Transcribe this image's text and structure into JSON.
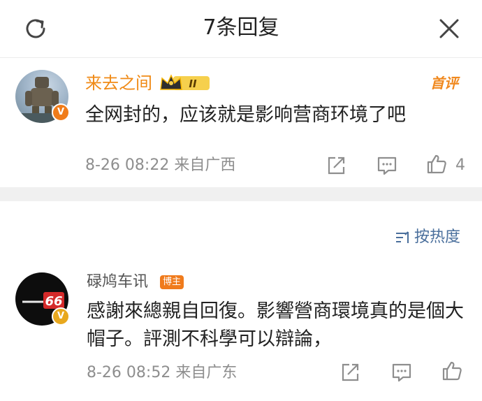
{
  "header": {
    "title": "7条回复"
  },
  "comment1": {
    "username": "来去之间",
    "level_badge": "II",
    "first_tag": "首评",
    "text": "全网封的，应该就是影响营商环境了吧",
    "timestamp": "8-26 08:22",
    "location": "来自广西",
    "likes": "4"
  },
  "sort": {
    "label": "按热度"
  },
  "comment2": {
    "username": "碌鸠车讯",
    "role_badge": "博主",
    "avatar_text": "66",
    "text": "感謝來總親自回復。影響營商環境真的是個大帽子。評測不科學可以辯論，",
    "timestamp": "8-26 08:52",
    "location": "来自广东"
  },
  "icons": [
    "refresh-icon",
    "close-icon",
    "crown-icon",
    "share-icon",
    "comment-icon",
    "like-icon",
    "sort-icon",
    "verified-badge-icon"
  ],
  "colors": {
    "username_orange": "#f08a16",
    "link_blue": "#4a6f9c",
    "meta_gray": "#8e8e8e",
    "badge_orange": "#f07b1c"
  }
}
